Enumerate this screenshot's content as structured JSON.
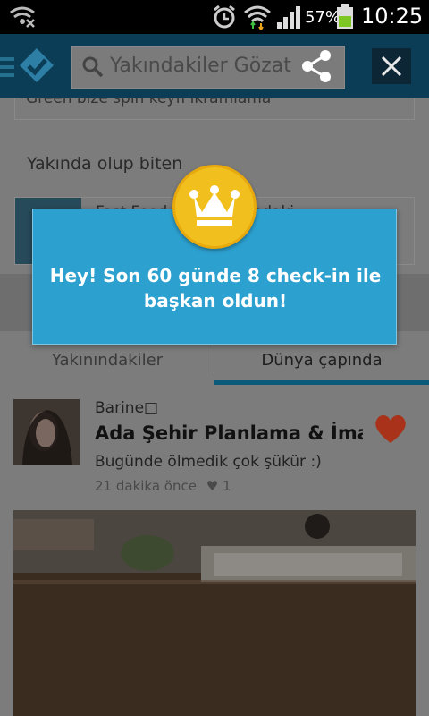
{
  "status_bar": {
    "battery_percent": "57%",
    "time": "10:25",
    "icons": [
      "usb-debug-icon",
      "alarm-icon",
      "wifi-icon",
      "signal-icon",
      "battery-icon"
    ]
  },
  "header": {
    "search_text": "Yakındakiler Gözat",
    "icons": [
      "hamburger-icon",
      "foursquare-logo-icon",
      "search-icon",
      "share-icon",
      "close-icon"
    ]
  },
  "background": {
    "top_card_text": "Green bize spin keyfi ikramlama",
    "section_heading": "Yakında olup biten",
    "nearby_card": {
      "title": "Fast Food … leri yakındaki:",
      "subtitle": "…"
    },
    "tabs": [
      {
        "label": "Yakınındakiler",
        "active": false
      },
      {
        "label": "Dünya çapında",
        "active": true
      }
    ],
    "feed": {
      "user": "Barine□",
      "venue": "Ada Şehir Planlama & İmar'...",
      "shout": "Bugünde ölmedik çok şükür :)",
      "time_ago": "21 dakika önce",
      "likes": "1"
    }
  },
  "dialog": {
    "message": "Hey! Son 60 günde 8 check-in ile başkan oldun!",
    "badge_icon": "crown-icon"
  },
  "colors": {
    "dialog_bg": "#2ca0cf",
    "badge": "#f1bf1e",
    "overlay": "#7c7c7c",
    "header": "#0b3e56"
  }
}
